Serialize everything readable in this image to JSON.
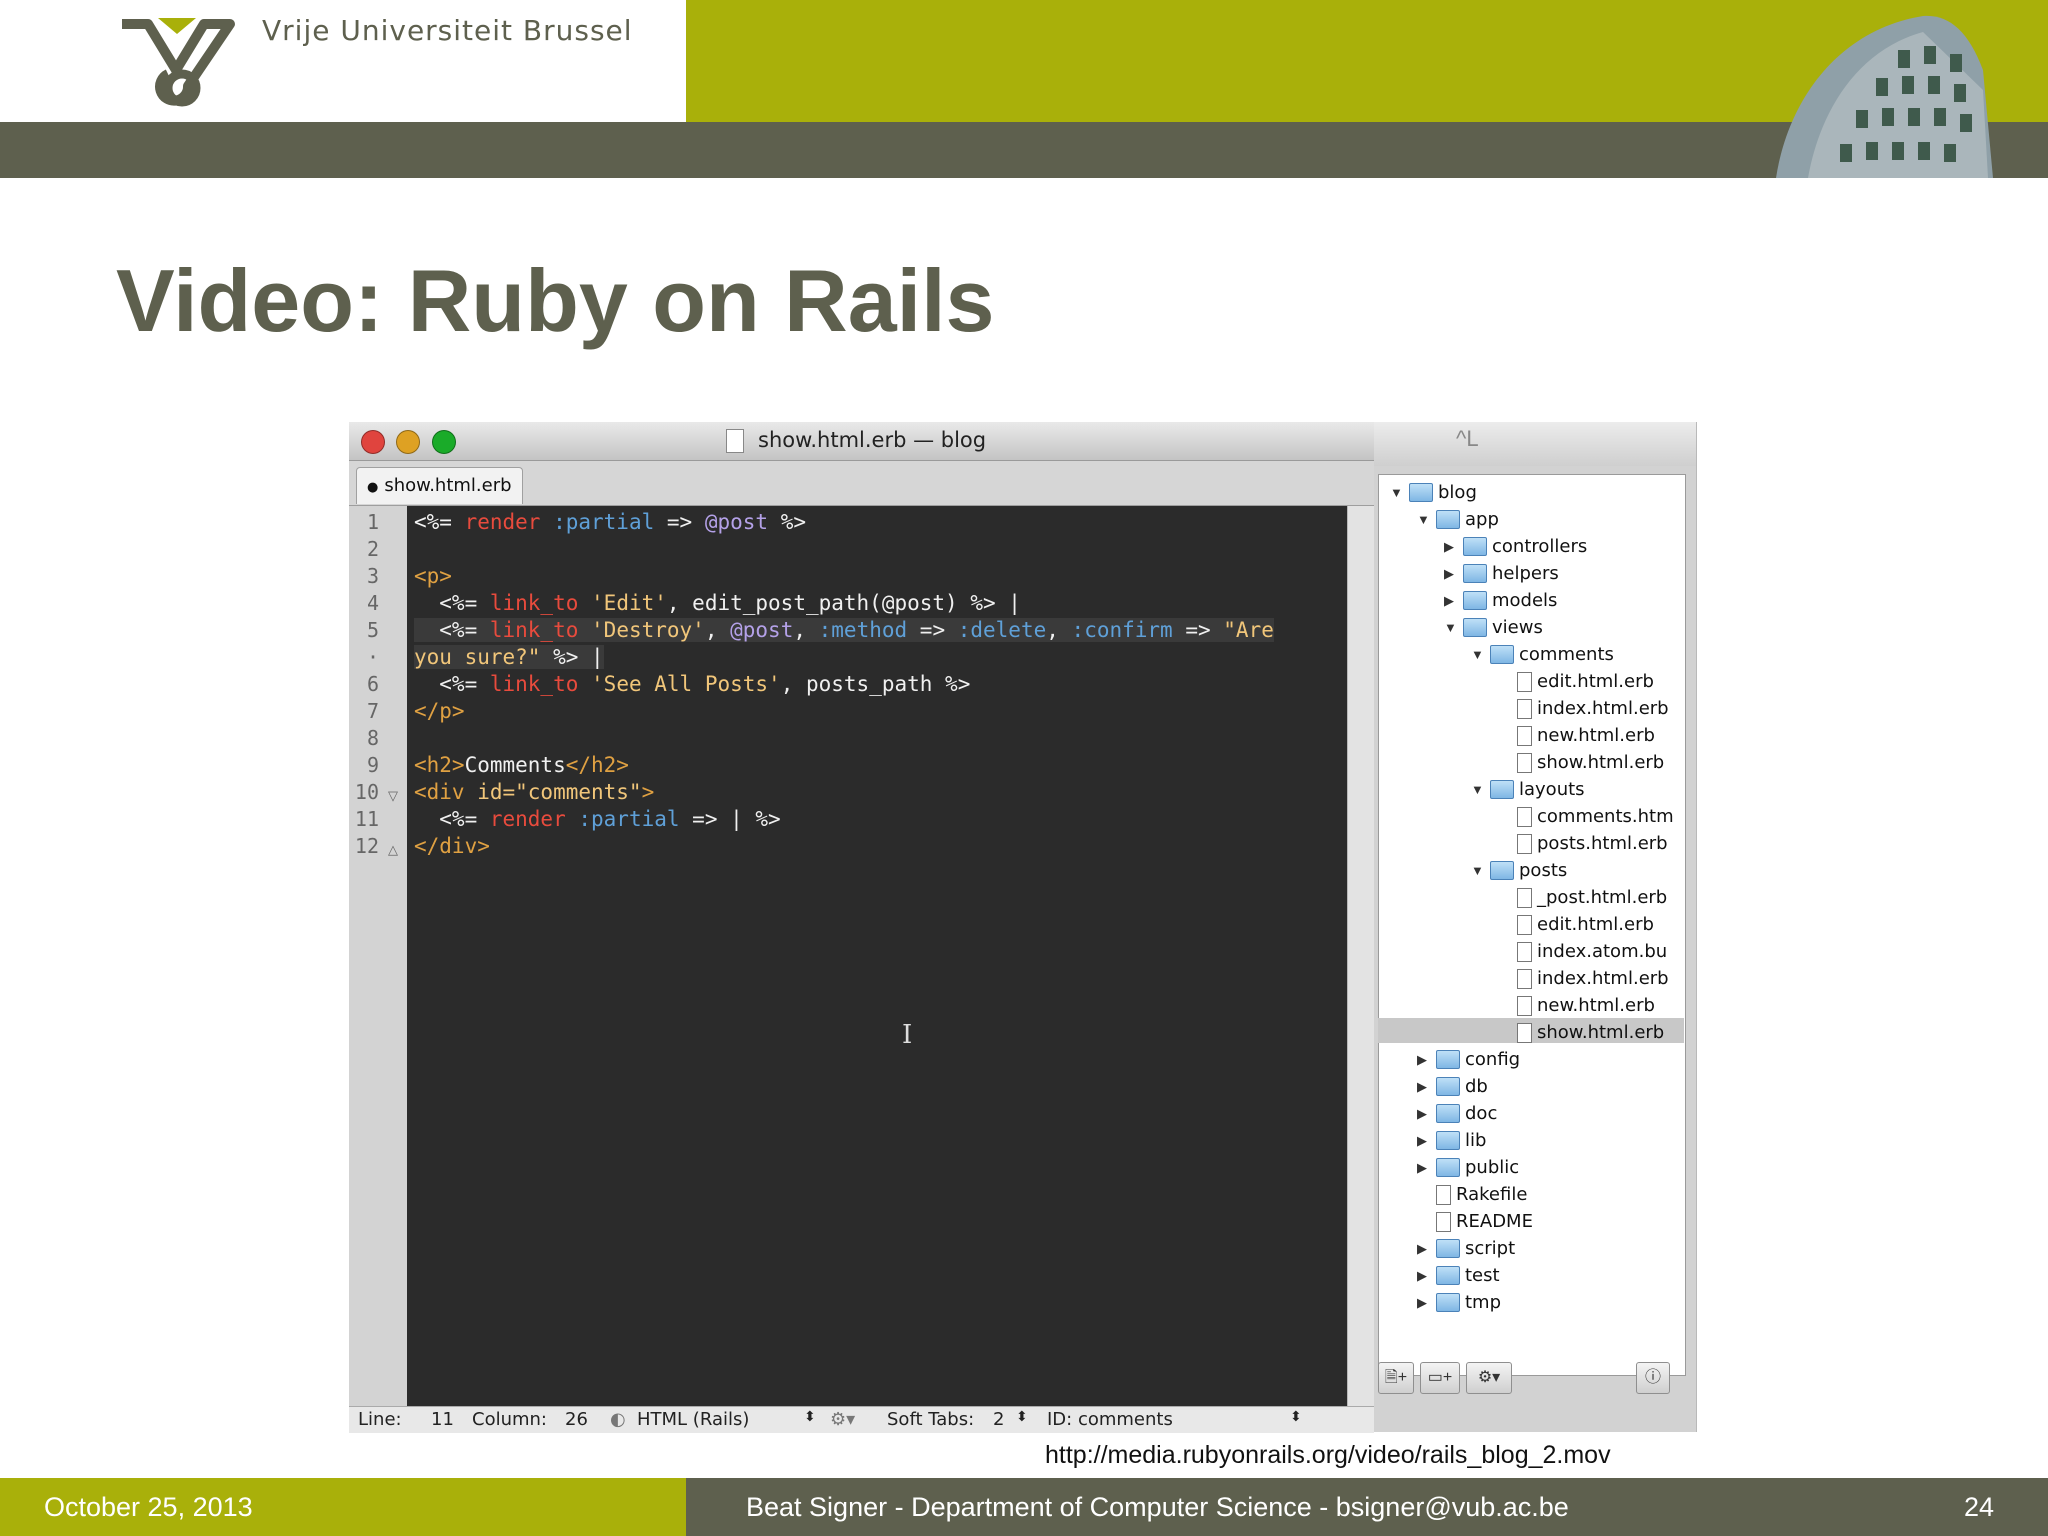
{
  "header": {
    "university": "Vrije Universiteit  Brussel",
    "logo": "vub-logo",
    "building_photo": "building-photo"
  },
  "slide": {
    "title": "Video: Ruby on Rails",
    "source_url": "http://media.rubyonrails.org/video/rails_blog_2.mov"
  },
  "footer": {
    "date": "October 25, 2013",
    "author": "Beat Signer - Department of Computer Science - bsigner@vub.ac.be",
    "page": "24"
  },
  "window": {
    "title": "show.html.erb — blog",
    "tab": "show.html.erb",
    "drawer_top_glyph": "^L",
    "traffic_lights": {
      "close": "#e0443e",
      "minimize": "#dea123",
      "zoom": "#1aab29"
    }
  },
  "code": {
    "line_numbers": [
      "1",
      "2",
      "3",
      "4",
      "5",
      "·",
      "6",
      "7",
      "8",
      "9",
      "10",
      "11",
      "12"
    ],
    "lines": [
      [
        [
          "k-erb",
          "<%= "
        ],
        [
          "k-red",
          "render"
        ],
        [
          "k-pl",
          " "
        ],
        [
          "k-sym",
          ":partial"
        ],
        [
          "k-pl",
          " => "
        ],
        [
          "k-ivar",
          "@post"
        ],
        [
          "k-pl",
          " %>"
        ]
      ],
      [],
      [
        [
          "k-tag",
          "<p>"
        ]
      ],
      [
        [
          "k-pl",
          "  <%= "
        ],
        [
          "k-red",
          "link_to"
        ],
        [
          "k-pl",
          " "
        ],
        [
          "k-str",
          "'Edit'"
        ],
        [
          "k-pl",
          ", edit_post_path(@post) %> |"
        ]
      ],
      [
        [
          "k-pl",
          "  <%= "
        ],
        [
          "k-red",
          "link_to"
        ],
        [
          "k-pl",
          " "
        ],
        [
          "k-str",
          "'Destroy'"
        ],
        [
          "k-pl",
          ", "
        ],
        [
          "k-ivar",
          "@post"
        ],
        [
          "k-pl",
          ", "
        ],
        [
          "k-sym",
          ":method"
        ],
        [
          "k-pl",
          " => "
        ],
        [
          "k-sym",
          ":delete"
        ],
        [
          "k-pl",
          ", "
        ],
        [
          "k-sym",
          ":confirm"
        ],
        [
          "k-pl",
          " => "
        ],
        [
          "k-str",
          "\"Are"
        ]
      ],
      [
        [
          "k-str",
          "you sure?\""
        ],
        [
          "k-pl",
          " %> |"
        ]
      ],
      [
        [
          "k-pl",
          "  <%= "
        ],
        [
          "k-red",
          "link_to"
        ],
        [
          "k-pl",
          " "
        ],
        [
          "k-str",
          "'See All Posts'"
        ],
        [
          "k-pl",
          ", posts_path %>"
        ]
      ],
      [
        [
          "k-tag",
          "</p>"
        ]
      ],
      [],
      [
        [
          "k-tag",
          "<h2>"
        ],
        [
          "k-pl",
          "Comments"
        ],
        [
          "k-tag",
          "</h2>"
        ]
      ],
      [
        [
          "k-tag",
          "<div "
        ],
        [
          "k-str",
          "id=\"comments\""
        ],
        [
          "k-tag",
          ">"
        ]
      ],
      [
        [
          "k-pl",
          "  <%= "
        ],
        [
          "k-red",
          "render"
        ],
        [
          "k-pl",
          " "
        ],
        [
          "k-sym",
          ":partial"
        ],
        [
          "k-pl",
          " => | %>"
        ]
      ],
      [
        [
          "k-tag",
          "</div>"
        ]
      ]
    ]
  },
  "statusbar": {
    "line_label": "Line:",
    "line_value": "11",
    "column_label": "Column:",
    "column_value": "26",
    "language": "HTML (Rails)",
    "tabs_label": "Soft Tabs:",
    "tabs_value": "2",
    "symbol": "ID: comments"
  },
  "tree": [
    {
      "label": "blog",
      "depth": 0,
      "type": "folder",
      "state": "open"
    },
    {
      "label": "app",
      "depth": 1,
      "type": "folder",
      "state": "open"
    },
    {
      "label": "controllers",
      "depth": 2,
      "type": "folder",
      "state": "closed"
    },
    {
      "label": "helpers",
      "depth": 2,
      "type": "folder",
      "state": "closed"
    },
    {
      "label": "models",
      "depth": 2,
      "type": "folder",
      "state": "closed"
    },
    {
      "label": "views",
      "depth": 2,
      "type": "folder",
      "state": "open"
    },
    {
      "label": "comments",
      "depth": 3,
      "type": "folder",
      "state": "open"
    },
    {
      "label": "edit.html.erb",
      "depth": 4,
      "type": "file"
    },
    {
      "label": "index.html.erb",
      "depth": 4,
      "type": "file"
    },
    {
      "label": "new.html.erb",
      "depth": 4,
      "type": "file"
    },
    {
      "label": "show.html.erb",
      "depth": 4,
      "type": "file"
    },
    {
      "label": "layouts",
      "depth": 3,
      "type": "folder",
      "state": "open"
    },
    {
      "label": "comments.htm",
      "depth": 4,
      "type": "file"
    },
    {
      "label": "posts.html.erb",
      "depth": 4,
      "type": "file"
    },
    {
      "label": "posts",
      "depth": 3,
      "type": "folder",
      "state": "open"
    },
    {
      "label": "_post.html.erb",
      "depth": 4,
      "type": "file"
    },
    {
      "label": "edit.html.erb",
      "depth": 4,
      "type": "file"
    },
    {
      "label": "index.atom.bu",
      "depth": 4,
      "type": "file"
    },
    {
      "label": "index.html.erb",
      "depth": 4,
      "type": "file"
    },
    {
      "label": "new.html.erb",
      "depth": 4,
      "type": "file"
    },
    {
      "label": "show.html.erb",
      "depth": 4,
      "type": "file",
      "selected": true
    },
    {
      "label": "config",
      "depth": 1,
      "type": "folder",
      "state": "closed"
    },
    {
      "label": "db",
      "depth": 1,
      "type": "folder",
      "state": "closed"
    },
    {
      "label": "doc",
      "depth": 1,
      "type": "folder",
      "state": "closed"
    },
    {
      "label": "lib",
      "depth": 1,
      "type": "folder",
      "state": "closed"
    },
    {
      "label": "public",
      "depth": 1,
      "type": "folder",
      "state": "closed"
    },
    {
      "label": "Rakefile",
      "depth": 1,
      "type": "file"
    },
    {
      "label": "README",
      "depth": 1,
      "type": "file"
    },
    {
      "label": "script",
      "depth": 1,
      "type": "folder",
      "state": "closed"
    },
    {
      "label": "test",
      "depth": 1,
      "type": "folder",
      "state": "closed"
    },
    {
      "label": "tmp",
      "depth": 1,
      "type": "folder",
      "state": "closed"
    }
  ]
}
